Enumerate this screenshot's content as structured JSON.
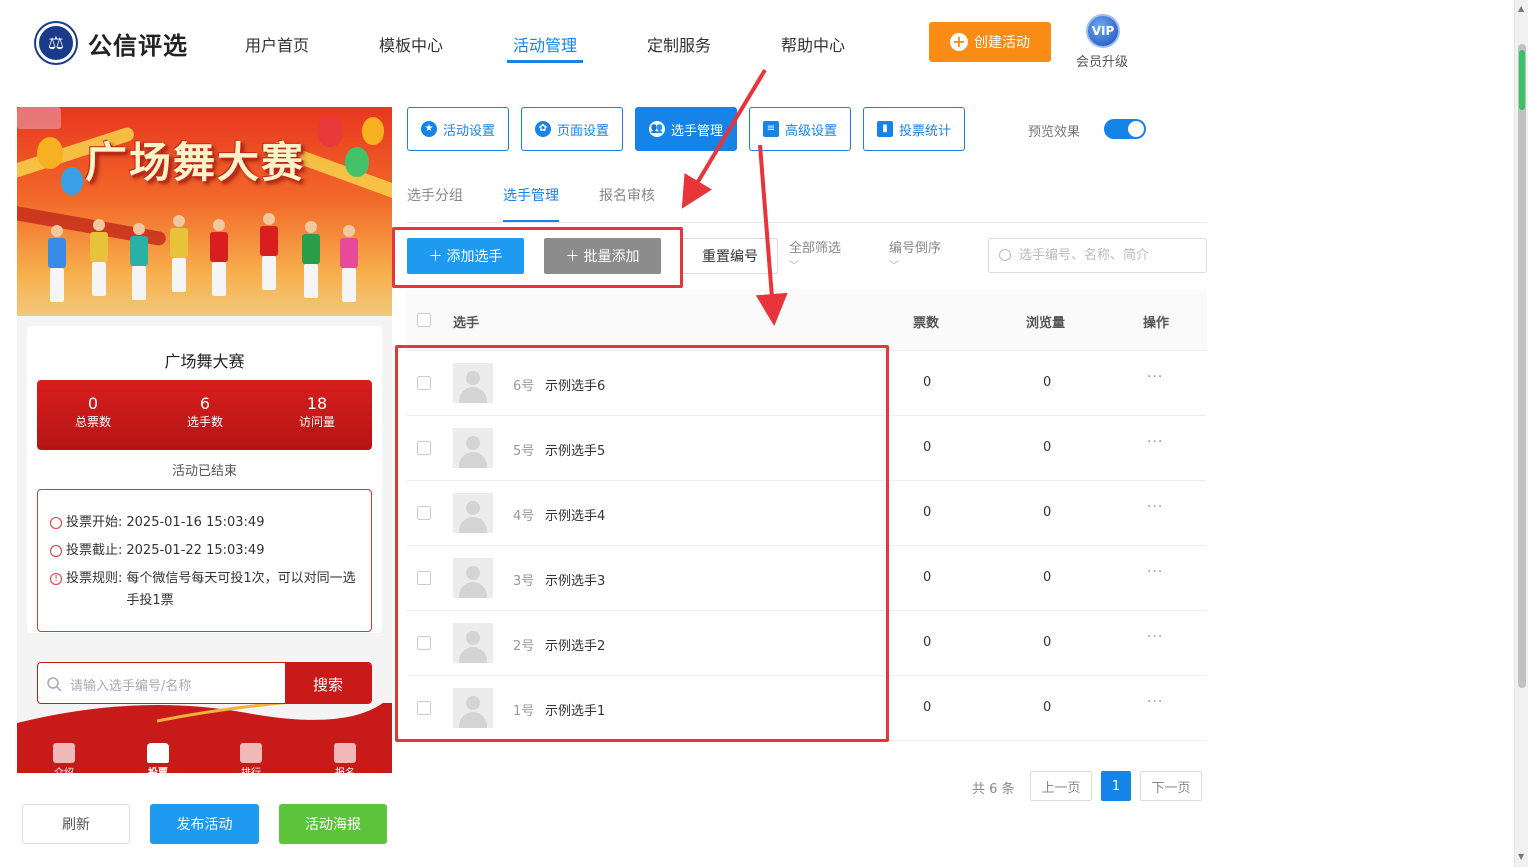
{
  "header": {
    "logo_text": "公信评选",
    "nav": [
      "用户首页",
      "模板中心",
      "活动管理",
      "定制服务",
      "帮助中心"
    ],
    "active_nav": "活动管理",
    "create_button": "创建活动",
    "vip_badge": "VIP",
    "vip_label": "会员升级"
  },
  "preview": {
    "banner_title": "广场舞大赛",
    "card_title": "广场舞大赛",
    "stats": [
      {
        "value": "0",
        "label": "总票数"
      },
      {
        "value": "6",
        "label": "选手数"
      },
      {
        "value": "18",
        "label": "访问量"
      }
    ],
    "status": "活动已结束",
    "rules": [
      {
        "label": "投票开始:",
        "value": "2025-01-16 15:03:49"
      },
      {
        "label": "投票截止:",
        "value": "2025-01-22 15:03:49"
      },
      {
        "label": "投票规则:",
        "value": "每个微信号每天可投1次，可以对同一选",
        "value2": "手投1票"
      }
    ],
    "search_placeholder": "请输入选手编号/名称",
    "search_button": "搜索",
    "bottom_nav": [
      "介绍",
      "投票",
      "排行",
      "报名"
    ]
  },
  "bottom_buttons": {
    "refresh": "刷新",
    "publish": "发布活动",
    "poster": "活动海报"
  },
  "toolbar": {
    "tabs": [
      "活动设置",
      "页面设置",
      "选手管理",
      "高级设置",
      "投票统计"
    ],
    "active_tab": "选手管理",
    "preview_label": "预览效果",
    "preview_on": true
  },
  "subtabs": [
    "选手分组",
    "选手管理",
    "报名审核"
  ],
  "actions": {
    "add": "添加选手",
    "batch_add": "批量添加",
    "reset_number": "重置编号",
    "filter_all": "全部筛选",
    "sort": "编号倒序",
    "search_placeholder": "选手编号、名称、简介"
  },
  "table": {
    "headers": [
      "选手",
      "票数",
      "浏览量",
      "操作"
    ],
    "rows": [
      {
        "number": "6号",
        "name": "示例选手6",
        "votes": "0",
        "views": "0"
      },
      {
        "number": "5号",
        "name": "示例选手5",
        "votes": "0",
        "views": "0"
      },
      {
        "number": "4号",
        "name": "示例选手4",
        "votes": "0",
        "views": "0"
      },
      {
        "number": "3号",
        "name": "示例选手3",
        "votes": "0",
        "views": "0"
      },
      {
        "number": "2号",
        "name": "示例选手2",
        "votes": "0",
        "views": "0"
      },
      {
        "number": "1号",
        "name": "示例选手1",
        "votes": "0",
        "views": "0"
      }
    ],
    "more_icon": "···"
  },
  "pagination": {
    "total": "共 6 条",
    "prev": "上一页",
    "current": "1",
    "next": "下一页"
  },
  "colors": {
    "primary": "#1683e8",
    "orange": "#fa8c16",
    "red": "#c91a1a",
    "green": "#52c41a",
    "annotation": "#e8343b"
  }
}
